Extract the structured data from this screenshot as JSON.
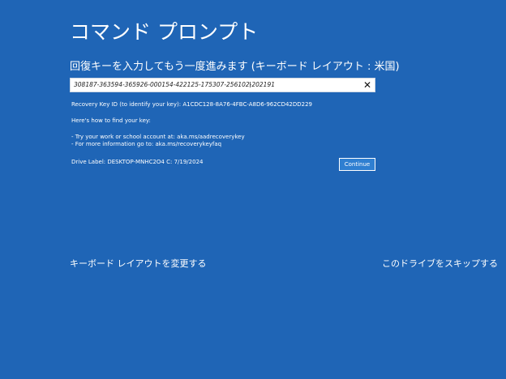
{
  "page": {
    "title": "コマンド プロンプト",
    "prompt": "回復キーを入力してもう一度進みます (キーボード レイアウト : 米国)"
  },
  "key_input": {
    "value": "308187-363594-365926-000154-422125-175307-256102-202191",
    "clear_icon": "close-icon",
    "cursor_icon": "text-cursor-icon"
  },
  "info": {
    "recovery_key_id": "Recovery Key ID (to identify your key): A1CDC128-8A76-4FBC-A8D6-962CD42DD229",
    "how_to_find": "Here's how to find your key:",
    "tip_account": "- Try your work or school account at: aka.ms/aadrecoverykey",
    "tip_more": "- For more information go to: aka.ms/recoverykeyfaq",
    "drive_label": "Drive Label: DESKTOP-MNHC2O4 C: 7/19/2024"
  },
  "buttons": {
    "continue": "Continue"
  },
  "links": {
    "change_keyboard": "キーボード レイアウトを変更する",
    "skip_drive": "このドライブをスキップする"
  },
  "colors": {
    "background": "#1f65b6",
    "button": "#2f7fd1"
  }
}
